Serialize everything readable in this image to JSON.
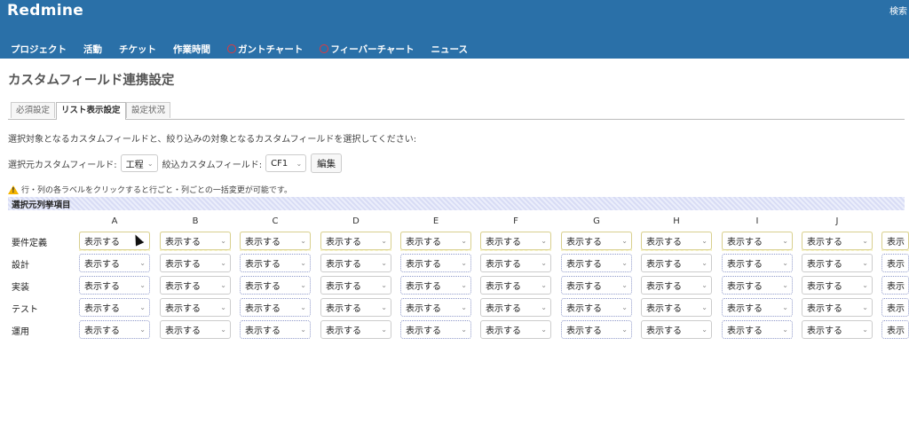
{
  "header": {
    "app_title": "Redmine",
    "search_label": "検索",
    "menu": [
      {
        "label": "プロジェクト",
        "icon": ""
      },
      {
        "label": "活動",
        "icon": ""
      },
      {
        "label": "チケット",
        "icon": ""
      },
      {
        "label": "作業時間",
        "icon": ""
      },
      {
        "label": "ガントチャート",
        "icon": "gantt-icon"
      },
      {
        "label": "フィーバーチャート",
        "icon": "fever-icon"
      },
      {
        "label": "ニュース",
        "icon": ""
      }
    ]
  },
  "page": {
    "title": "カスタムフィールド連携設定",
    "tabs": [
      "必須設定",
      "リスト表示設定",
      "設定状況"
    ],
    "selected_tab": "リスト表示設定",
    "description": "選択対象となるカスタムフィールドと、絞り込みの対象となるカスタムフィールドを選択してください:",
    "source_field_label": "選択元カスタムフィールド:",
    "source_field_value": "工程",
    "filter_field_label": "絞込カスタムフィールド:",
    "filter_field_value": "CF1",
    "edit_button": "編集",
    "notice": "行・列の各ラベルをクリックすると行ごと・列ごとの一括変更が可能です。",
    "section_title": "選択元列挙項目"
  },
  "grid": {
    "columns": [
      "A",
      "B",
      "C",
      "D",
      "E",
      "F",
      "G",
      "H",
      "I",
      "J"
    ],
    "rows": [
      "要件定義",
      "設計",
      "実装",
      "テスト",
      "運用"
    ],
    "cell_value": "表示する",
    "overflow_cell_value": "表示"
  },
  "colors": {
    "header_bg": "#2a70a8",
    "highlight_row": "#f7f3c7",
    "section_bar": "#d8dcf5"
  }
}
